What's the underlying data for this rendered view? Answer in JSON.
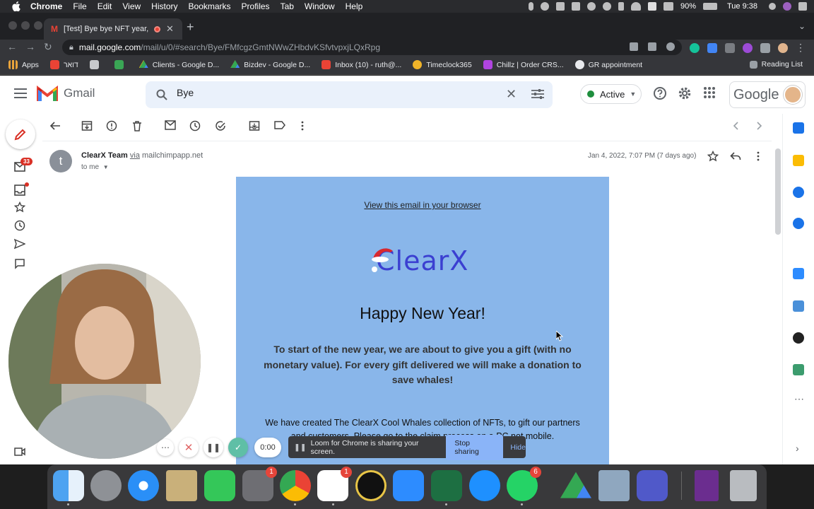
{
  "menubar": {
    "app": "Chrome",
    "items": [
      "File",
      "Edit",
      "View",
      "History",
      "Bookmarks",
      "Profiles",
      "Tab",
      "Window",
      "Help"
    ],
    "battery": "90%",
    "clock": "Tue 9:38"
  },
  "browser": {
    "tab_title": "[Test] Bye bye NFT year, w",
    "url_host": "mail.google.com",
    "url_path": "/mail/u/0/#search/Bye/FMfcgzGmtNWwZHbdvKSfvtvpxjLQxRpg",
    "bookmarks": [
      {
        "label": "Apps",
        "icon": "apps-grid-icon"
      },
      {
        "label": "דואר",
        "icon": "gmail-icon"
      },
      {
        "label": "",
        "icon": "folder-icon"
      },
      {
        "label": "",
        "icon": "timeclock-icon"
      },
      {
        "label": "Clients - Google D...",
        "icon": "google-drive-icon"
      },
      {
        "label": "Bizdev - Google D...",
        "icon": "google-drive-icon"
      },
      {
        "label": "Inbox (10) - ruth@...",
        "icon": "gmail-icon"
      },
      {
        "label": "Timeclock365",
        "icon": "timeclock365-icon"
      },
      {
        "label": "Chillz | Order CRS...",
        "icon": "chillz-icon"
      },
      {
        "label": "GR appointment",
        "icon": "globe-icon"
      }
    ],
    "reading_list": "Reading List"
  },
  "gmail": {
    "brand": "Gmail",
    "search_value": "Bye",
    "status": "Active",
    "google_wordmark": "Google",
    "inbox_badge": "33"
  },
  "message": {
    "avatar_letter": "t",
    "sender_name": "ClearX Team",
    "via_label": "via",
    "via_domain": "mailchimpapp.net",
    "to": "to me",
    "date": "Jan 4, 2022, 7:07 PM (7 days ago)"
  },
  "email": {
    "view_in_browser": "View this email in your browser",
    "logo_text": "ClearX",
    "heading": "Happy New Year!",
    "paragraph1": "To start of the new year, we are about to give you a gift (with no monetary value). For every gift delivered we will make a donation to save whales!",
    "paragraph2": "We have created The ClearX Cool Whales collection of NFTs, to gift our partners and customers. Please go to the claim process on a PC not mobile.",
    "bg_color": "#89b6ea"
  },
  "loom": {
    "timer": "0:00",
    "share_message": "Loom for Chrome is sharing your screen.",
    "stop_label": "Stop sharing",
    "hide_label": "Hide"
  },
  "dock": {
    "badges": {
      "system_preferences": "1",
      "slack": "1",
      "whatsapp": "6"
    }
  }
}
